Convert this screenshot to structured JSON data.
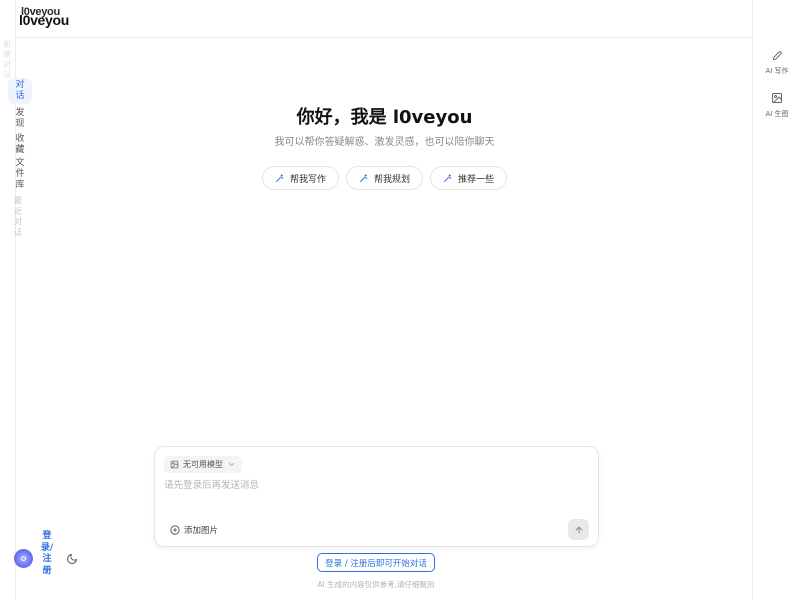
{
  "app": {
    "logo": "l0veyou",
    "logo_overlay": "l0veyou"
  },
  "sidebar": {
    "ghost_text": "新建对话",
    "items": [
      {
        "label": "对话",
        "active": true
      },
      {
        "label": "发现",
        "active": false
      },
      {
        "label": "收藏",
        "active": false
      },
      {
        "label": "文件库",
        "active": false
      }
    ],
    "recent_label": "最近对话",
    "login_label": "登录/注册"
  },
  "right_rail": {
    "items": [
      {
        "label": "AI 写作",
        "icon": "pen-icon"
      },
      {
        "label": "AI 生图",
        "icon": "image-icon"
      }
    ]
  },
  "hero": {
    "title": "你好，我是 l0veyou",
    "subtitle": "我可以帮你答疑解惑、激发灵感，也可以陪你聊天"
  },
  "suggestions": [
    {
      "label": "帮我写作",
      "icon": "magic-wand-icon"
    },
    {
      "label": "帮我规划",
      "icon": "magic-wand-icon"
    },
    {
      "label": "推荐一些",
      "icon": "magic-wand-icon"
    }
  ],
  "composer": {
    "model_label": "无可用模型",
    "placeholder": "请先登录后再发送消息",
    "add_image_label": "添加图片"
  },
  "footer": {
    "login_cta": "登录 / 注册后即可开始对话",
    "disclaimer": "AI 生成的内容仅供参考,请仔细甄别"
  },
  "colors": {
    "accent": "#2f6fe6",
    "border": "#ececec",
    "muted_text": "#888888"
  }
}
